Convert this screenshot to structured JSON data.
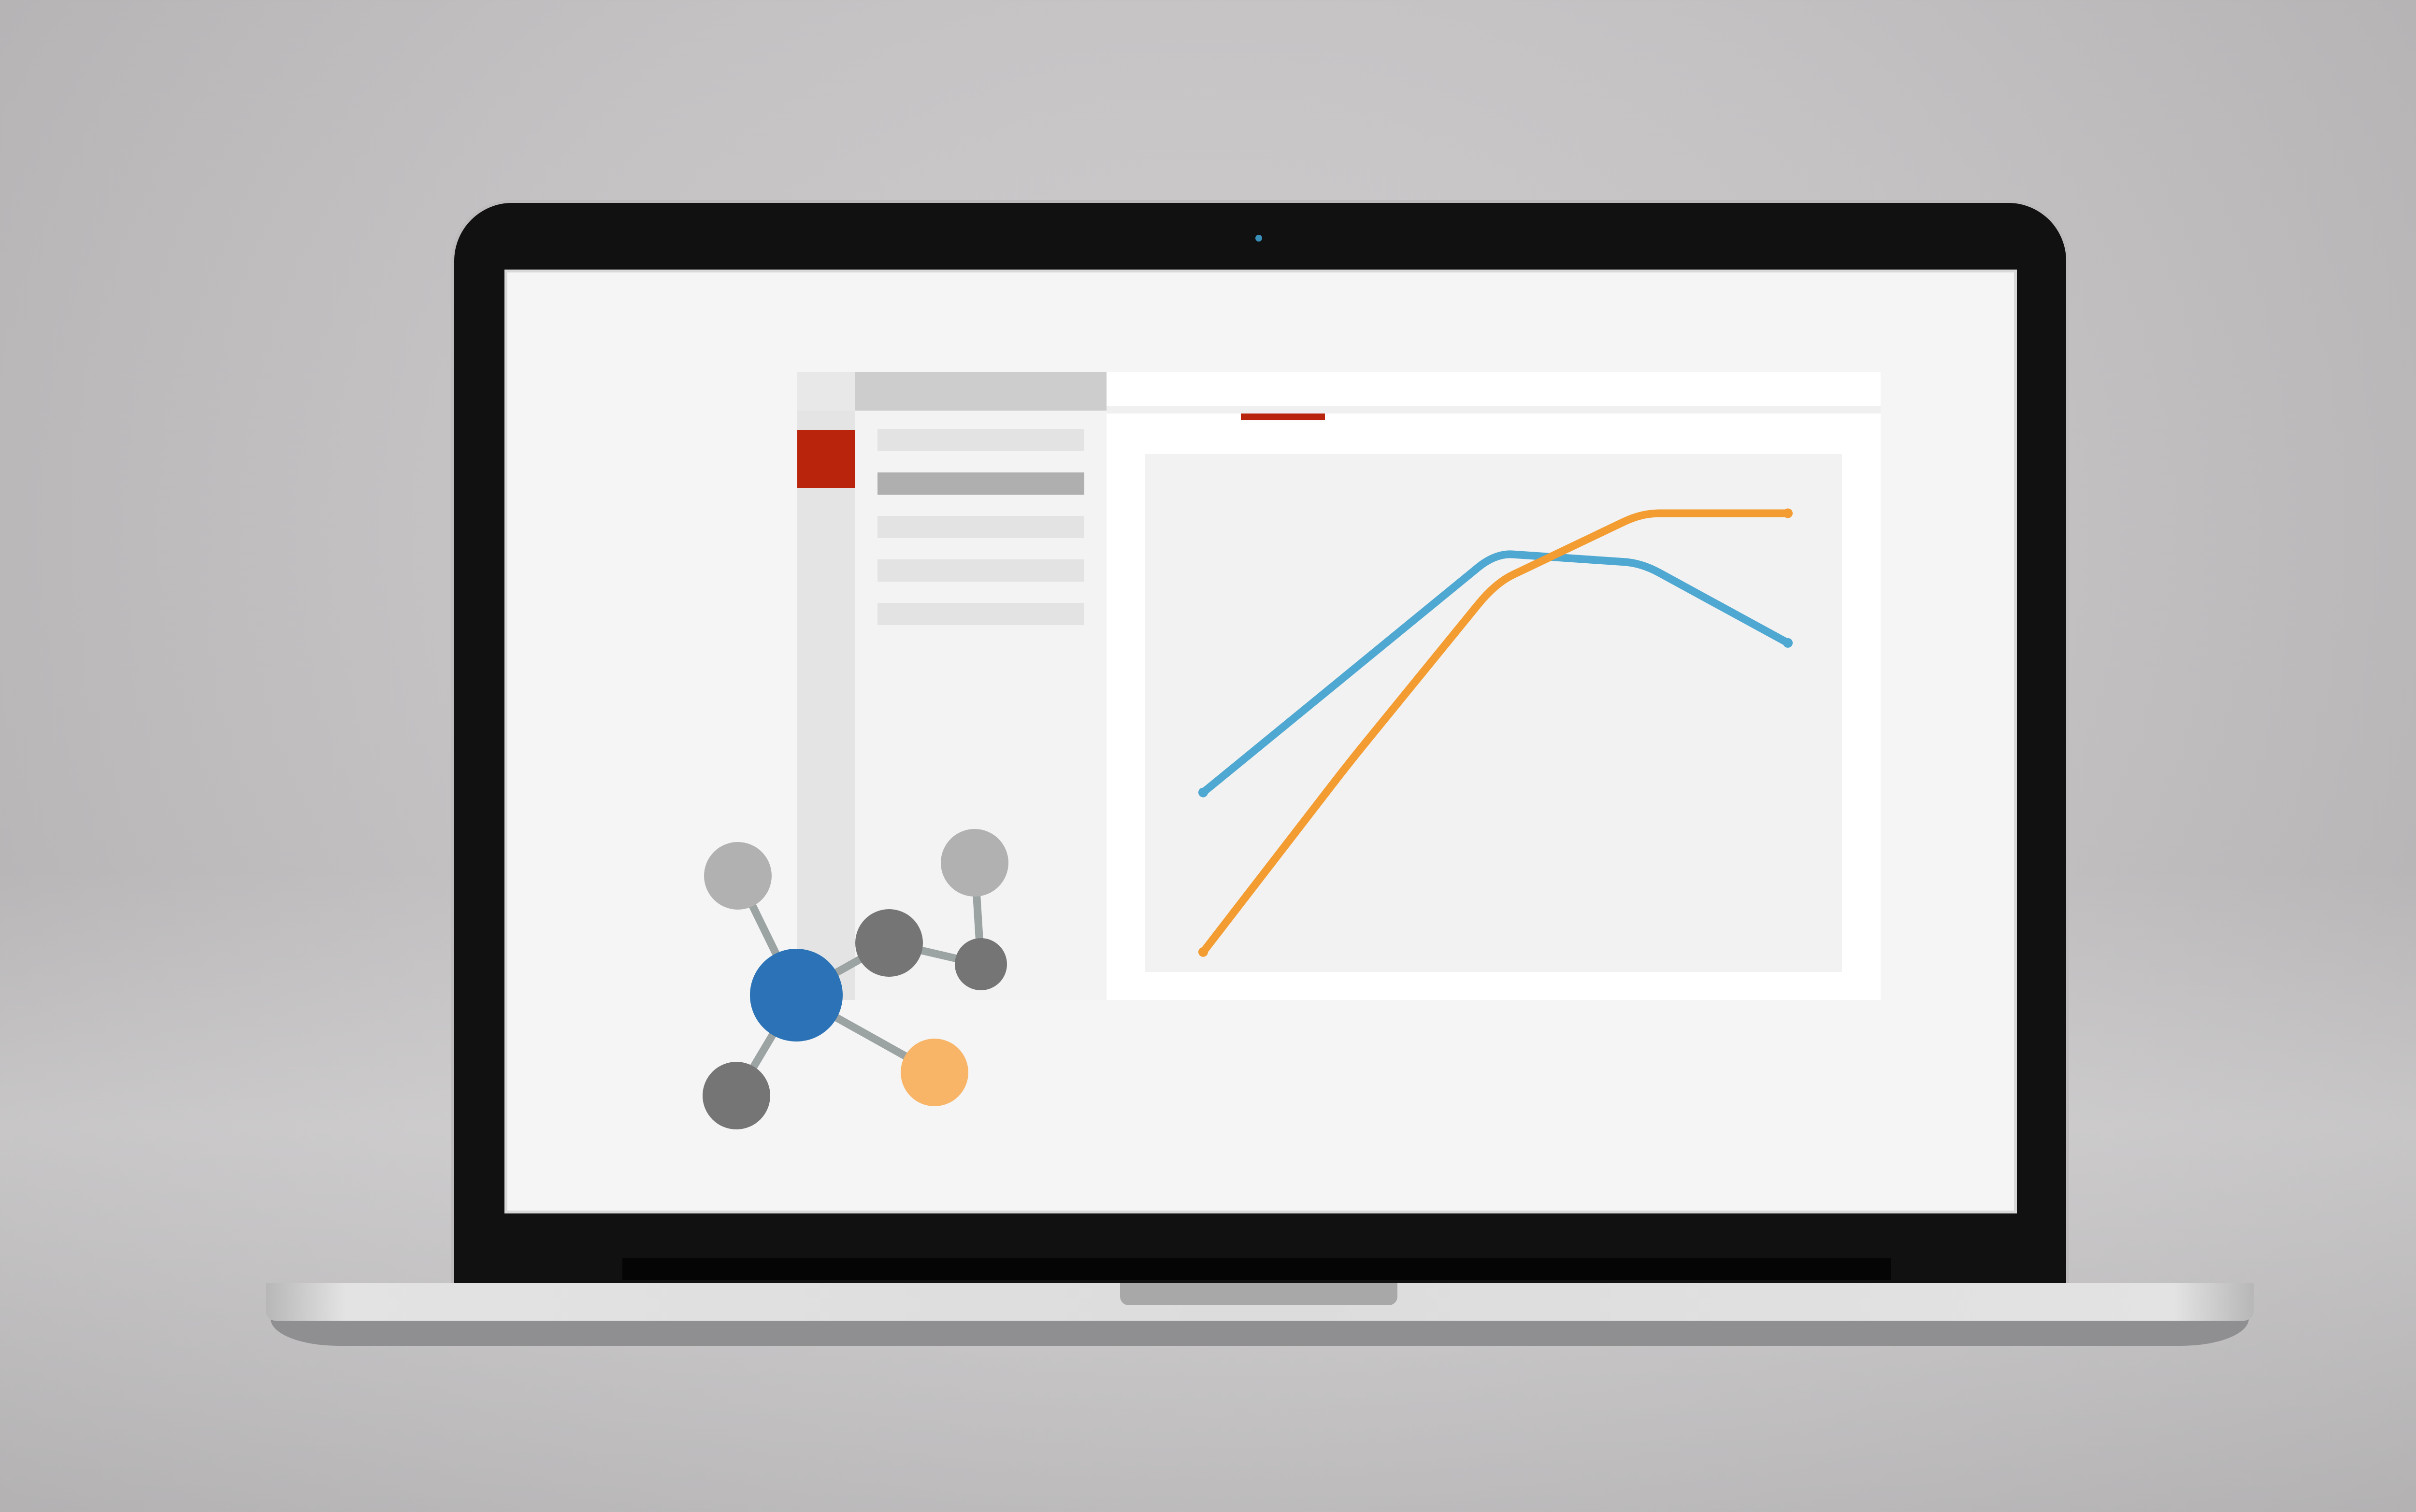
{
  "scene": {
    "subject": "laptop",
    "screen_background": "#f5f5f5",
    "accent_color": "#b8240c"
  },
  "app": {
    "title": "",
    "rail": {
      "active_index": 1
    },
    "sidebar": {
      "selected_index": 1,
      "items": [
        {
          "label": ""
        },
        {
          "label": ""
        },
        {
          "label": ""
        },
        {
          "label": ""
        },
        {
          "label": ""
        }
      ]
    },
    "tabs": {
      "active_index": 0
    }
  },
  "chart_data": {
    "type": "line",
    "title": "",
    "xlabel": "",
    "ylabel": "",
    "x": [
      0,
      1,
      2,
      3,
      4
    ],
    "xlim": [
      0,
      4
    ],
    "ylim": [
      0,
      1
    ],
    "grid": false,
    "legend": "none",
    "series": [
      {
        "color": "#4fa8d1",
        "values": [
          0.36,
          0.6,
          0.84,
          0.82,
          0.66
        ]
      },
      {
        "color": "#f39c32",
        "values": [
          0.04,
          0.42,
          0.78,
          0.92,
          0.92
        ]
      }
    ]
  },
  "molecule": {
    "icon": "molecule-icon",
    "colors": {
      "center": "#2b73b6",
      "dark": "#757575",
      "light": "#b1b1b1",
      "accent": "#f8b568",
      "bond": "#9ba3a3"
    }
  }
}
